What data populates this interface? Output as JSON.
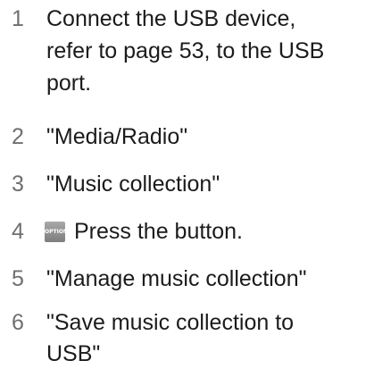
{
  "steps": [
    {
      "number": "1",
      "lines": [
        "Connect the USB device,",
        "refer to page 53, to the USB",
        "port."
      ]
    },
    {
      "number": "2",
      "lines": [
        "\"Media/Radio\""
      ]
    },
    {
      "number": "3",
      "lines": [
        "\"Music collection\""
      ]
    },
    {
      "number": "4",
      "button_label": "OPTION",
      "text": "Press the button."
    },
    {
      "number": "5",
      "lines": [
        "\"Manage music collection\""
      ]
    },
    {
      "number": "6",
      "lines": [
        "\"Save music collection to",
        "USB\""
      ]
    }
  ]
}
